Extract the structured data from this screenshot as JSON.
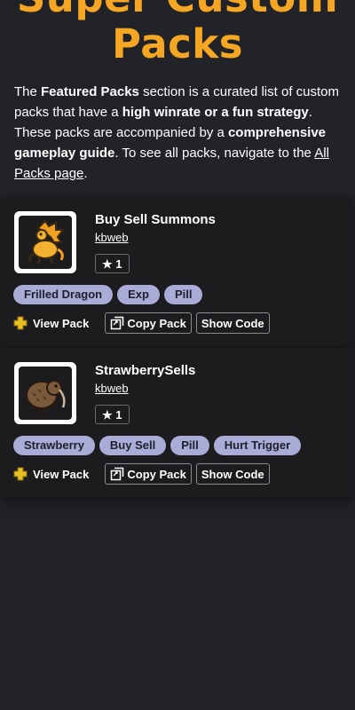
{
  "hero": {
    "title_line1": "Super Custom",
    "title_line2": "Packs"
  },
  "intro": {
    "p1": "The ",
    "b1": "Featured Packs",
    "p2": " section is a curated list of custom packs that have a ",
    "b2": "high winrate or a fun strategy",
    "p3": ". These packs are accompanied by a ",
    "b3": "comprehensive gameplay guide",
    "p4": ". To see all packs, navigate to the ",
    "link": "All Packs page",
    "p5": "."
  },
  "packs": [
    {
      "title": "Buy Sell Summons",
      "author": "kbweb",
      "rating": "★ 1",
      "icon": "frilled-dragon-icon",
      "tags": [
        "Frilled Dragon",
        "Exp",
        "Pill"
      ],
      "view_label": "View Pack",
      "copy_label": "Copy Pack",
      "show_label": "Show Code"
    },
    {
      "title": "StrawberrySells",
      "author": "kbweb",
      "rating": "★ 1",
      "icon": "kiwi-icon",
      "tags": [
        "Strawberry",
        "Buy Sell",
        "Pill",
        "Hurt Trigger"
      ],
      "view_label": "View Pack",
      "copy_label": "Copy Pack",
      "show_label": "Show Code"
    }
  ],
  "colors": {
    "accent": "#f5a623",
    "tag_bg": "#a8acd6",
    "card_bg": "#1c1c1f",
    "page_bg": "#222328"
  }
}
